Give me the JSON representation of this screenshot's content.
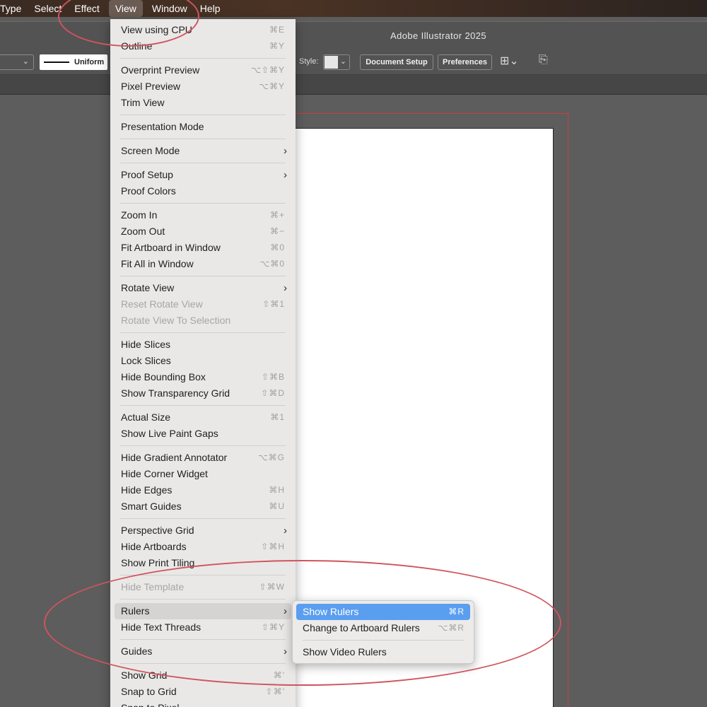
{
  "menubar": {
    "items": [
      "Type",
      "Select",
      "Effect",
      "View",
      "Window",
      "Help"
    ],
    "active": "View"
  },
  "window": {
    "title": "Adobe Illustrator 2025"
  },
  "controlbar": {
    "stroke_profile": "Uniform",
    "style_label": "Style:",
    "document_setup": "Document Setup",
    "preferences": "Preferences"
  },
  "view_menu": {
    "items": [
      {
        "label": "View using CPU",
        "shortcut": "⌘E"
      },
      {
        "label": "Outline",
        "shortcut": "⌘Y"
      },
      {
        "separator": true
      },
      {
        "label": "Overprint Preview",
        "shortcut": "⌥⇧⌘Y"
      },
      {
        "label": "Pixel Preview",
        "shortcut": "⌥⌘Y"
      },
      {
        "label": "Trim View",
        "shortcut": ""
      },
      {
        "separator": true
      },
      {
        "label": "Presentation Mode",
        "shortcut": ""
      },
      {
        "separator": true
      },
      {
        "label": "Screen Mode",
        "submenu": true
      },
      {
        "separator": true
      },
      {
        "label": "Proof Setup",
        "submenu": true
      },
      {
        "label": "Proof Colors",
        "shortcut": ""
      },
      {
        "separator": true
      },
      {
        "label": "Zoom In",
        "shortcut": "⌘+"
      },
      {
        "label": "Zoom Out",
        "shortcut": "⌘−"
      },
      {
        "label": "Fit Artboard in Window",
        "shortcut": "⌘0"
      },
      {
        "label": "Fit All in Window",
        "shortcut": "⌥⌘0"
      },
      {
        "separator": true
      },
      {
        "label": "Rotate View",
        "submenu": true
      },
      {
        "label": "Reset Rotate View",
        "shortcut": "⇧⌘1",
        "disabled": true
      },
      {
        "label": "Rotate View To Selection",
        "shortcut": "",
        "disabled": true
      },
      {
        "separator": true
      },
      {
        "label": "Hide Slices",
        "shortcut": ""
      },
      {
        "label": "Lock Slices",
        "shortcut": ""
      },
      {
        "label": "Hide Bounding Box",
        "shortcut": "⇧⌘B"
      },
      {
        "label": "Show Transparency Grid",
        "shortcut": "⇧⌘D"
      },
      {
        "separator": true
      },
      {
        "label": "Actual Size",
        "shortcut": "⌘1"
      },
      {
        "label": "Show Live Paint Gaps",
        "shortcut": ""
      },
      {
        "separator": true
      },
      {
        "label": "Hide Gradient Annotator",
        "shortcut": "⌥⌘G"
      },
      {
        "label": "Hide Corner Widget",
        "shortcut": ""
      },
      {
        "label": "Hide Edges",
        "shortcut": "⌘H"
      },
      {
        "label": "Smart Guides",
        "shortcut": "⌘U"
      },
      {
        "separator": true
      },
      {
        "label": "Perspective Grid",
        "submenu": true
      },
      {
        "label": "Hide Artboards",
        "shortcut": "⇧⌘H"
      },
      {
        "label": "Show Print Tiling",
        "shortcut": ""
      },
      {
        "separator": true
      },
      {
        "label": "Hide Template",
        "shortcut": "⇧⌘W",
        "disabled": true
      },
      {
        "separator": true
      },
      {
        "label": "Rulers",
        "submenu": true,
        "highlight": true
      },
      {
        "label": "Hide Text Threads",
        "shortcut": "⇧⌘Y"
      },
      {
        "separator": true
      },
      {
        "label": "Guides",
        "submenu": true
      },
      {
        "separator": true
      },
      {
        "label": "Show Grid",
        "shortcut": "⌘'"
      },
      {
        "label": "Snap to Grid",
        "shortcut": "⇧⌘'"
      },
      {
        "label": "Snap to Pixel",
        "shortcut": ""
      }
    ]
  },
  "rulers_submenu": {
    "items": [
      {
        "label": "Show Rulers",
        "shortcut": "⌘R",
        "active": true
      },
      {
        "label": "Change to Artboard Rulers",
        "shortcut": "⌥⌘R"
      },
      {
        "separator": true
      },
      {
        "label": "Show Video Rulers",
        "shortcut": ""
      }
    ]
  },
  "colors": {
    "menu_highlight": "#5a9ef0",
    "annotation": "#d0545e",
    "bleed": "#d23b3b"
  }
}
